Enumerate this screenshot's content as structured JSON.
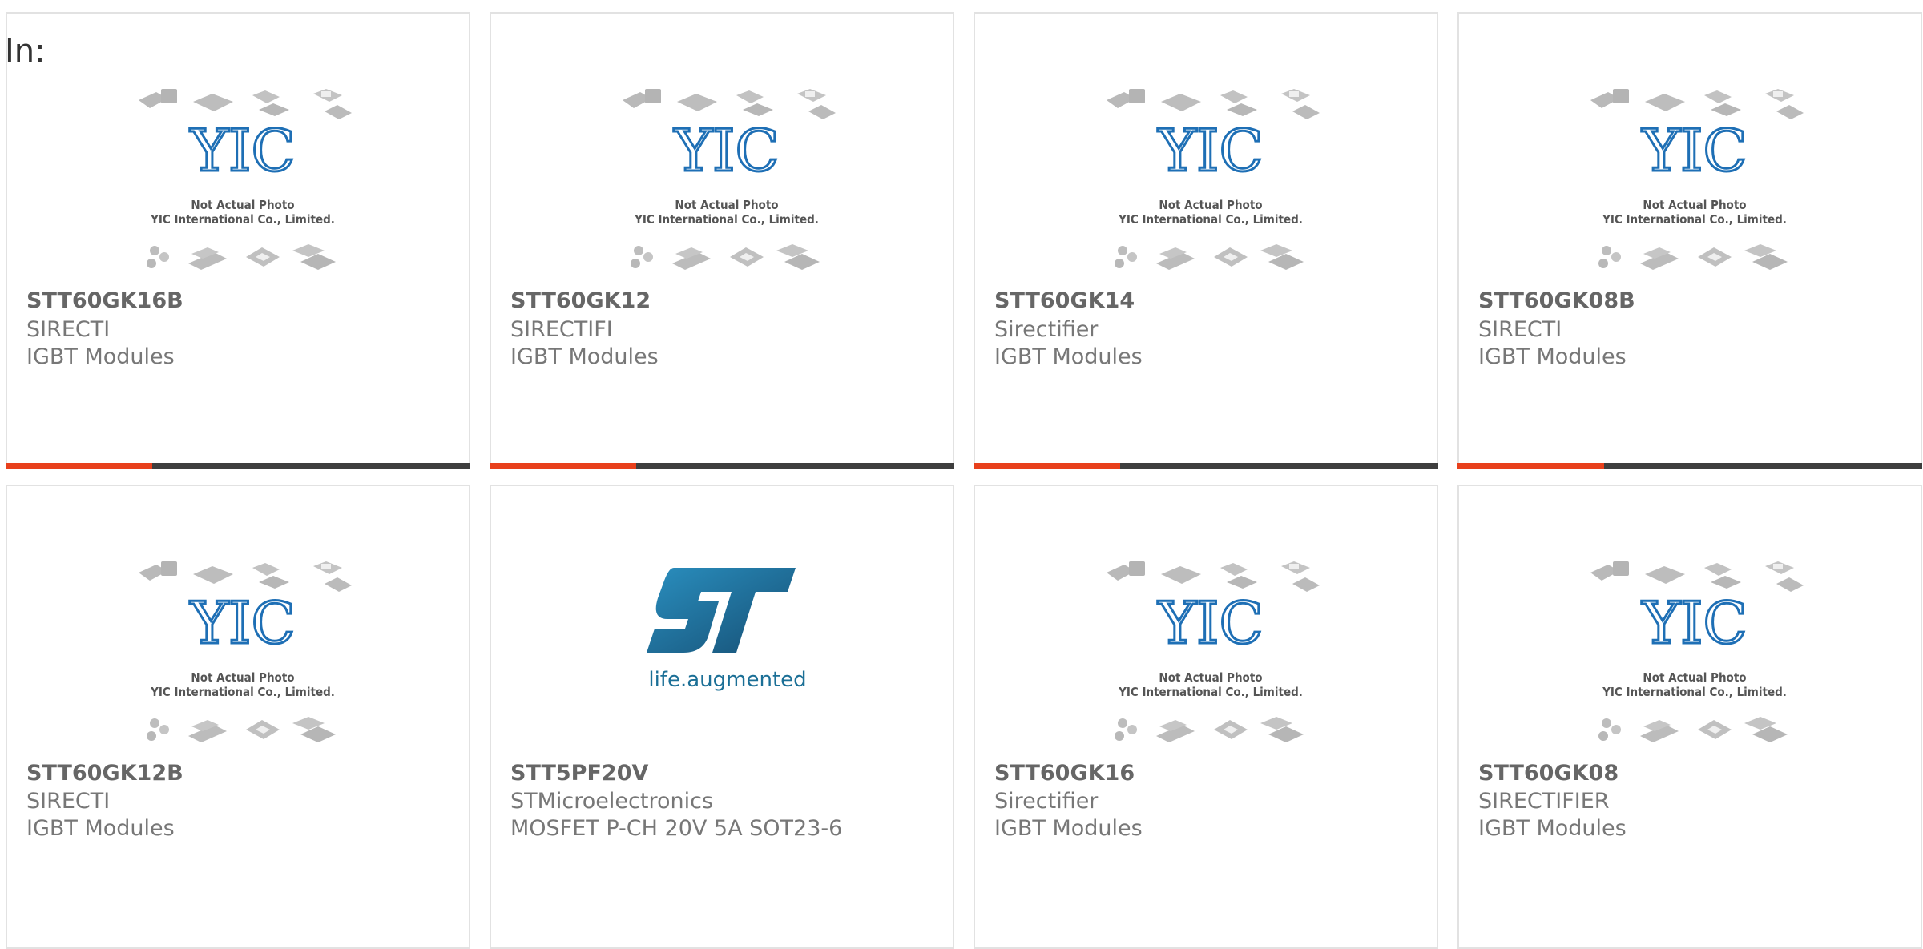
{
  "filter": {
    "label": "In:"
  },
  "placeholder_image": {
    "brand": "YIC",
    "line1": "Not Actual Photo",
    "line2": "YIC International Co., Limited."
  },
  "st_logo": {
    "mark": "ST",
    "tagline": "life.augmented"
  },
  "colors": {
    "accent": "#e8401c",
    "bar": "#3e3e3e",
    "border": "#e2e2e2",
    "yic_blue": "#1e6fb5",
    "st_blue": "#1b6f96"
  },
  "products": [
    {
      "part": "STT60GK16B",
      "manufacturer": "SIRECTI",
      "description": "IGBT Modules",
      "image": "yic-placeholder",
      "progress": 0.315
    },
    {
      "part": "STT60GK12",
      "manufacturer": "SIRECTIFI",
      "description": "IGBT Modules",
      "image": "yic-placeholder",
      "progress": 0.315
    },
    {
      "part": "STT60GK14",
      "manufacturer": "Sirectifier",
      "description": "IGBT Modules",
      "image": "yic-placeholder",
      "progress": 0.315
    },
    {
      "part": "STT60GK08B",
      "manufacturer": "SIRECTI",
      "description": "IGBT Modules",
      "image": "yic-placeholder",
      "progress": 0.315
    },
    {
      "part": "STT60GK12B",
      "manufacturer": "SIRECTI",
      "description": "IGBT Modules",
      "image": "yic-placeholder"
    },
    {
      "part": "STT5PF20V",
      "manufacturer": "STMicroelectronics",
      "description": "MOSFET P-CH 20V 5A SOT23-6",
      "image": "st-logo"
    },
    {
      "part": "STT60GK16",
      "manufacturer": "Sirectifier",
      "description": "IGBT Modules",
      "image": "yic-placeholder"
    },
    {
      "part": "STT60GK08",
      "manufacturer": "SIRECTIFIER",
      "description": "IGBT Modules",
      "image": "yic-placeholder"
    }
  ]
}
